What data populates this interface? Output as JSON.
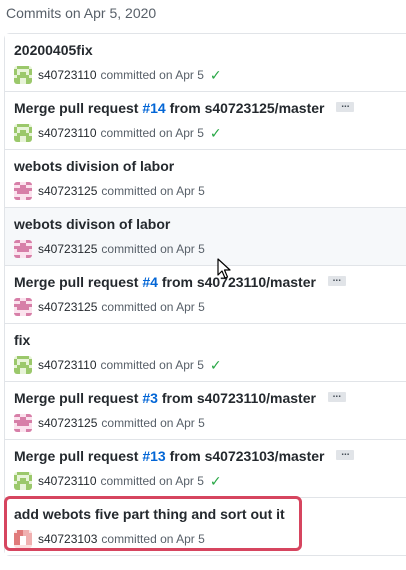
{
  "header": {
    "date_title": "Commits on Apr 5, 2020"
  },
  "commits": [
    {
      "title": "20200405fix",
      "pr": "",
      "after": "",
      "author": "s40723110",
      "date": "committed on Apr 5",
      "verified": true,
      "avatar": "green"
    },
    {
      "title": "Merge pull request ",
      "pr": "#14",
      "after": " from s40723125/master",
      "author": "s40723110",
      "date": "committed on Apr 5",
      "verified": true,
      "avatar": "green",
      "more": "..."
    },
    {
      "title": "webots division of labor",
      "pr": "",
      "after": "",
      "author": "s40723125",
      "date": "committed on Apr 5",
      "verified": false,
      "avatar": "pink"
    },
    {
      "title": "webots divison of labor",
      "pr": "",
      "after": "",
      "author": "s40723125",
      "date": "committed on Apr 5",
      "verified": false,
      "avatar": "pink"
    },
    {
      "title": "Merge pull request ",
      "pr": "#4",
      "after": " from s40723110/master",
      "author": "s40723125",
      "date": "committed on Apr 5",
      "verified": false,
      "avatar": "pink",
      "more": "..."
    },
    {
      "title": "fix",
      "pr": "",
      "after": "",
      "author": "s40723110",
      "date": "committed on Apr 5",
      "verified": true,
      "avatar": "green"
    },
    {
      "title": "Merge pull request ",
      "pr": "#3",
      "after": " from s40723110/master",
      "author": "s40723125",
      "date": "committed on Apr 5",
      "verified": false,
      "avatar": "pink",
      "more": "..."
    },
    {
      "title": "Merge pull request ",
      "pr": "#13",
      "after": " from s40723103/master",
      "author": "s40723110",
      "date": "committed on Apr 5",
      "verified": true,
      "avatar": "green",
      "more": "..."
    },
    {
      "title": "add webots five part thing and sort out it",
      "pr": "",
      "after": "",
      "author": "s40723103",
      "date": "committed on Apr 5",
      "verified": false,
      "avatar": "red"
    }
  ],
  "check_glyph": "✓",
  "colors": {
    "link": "#0366d6",
    "verified": "#28a745",
    "highlight": "#d6455f"
  }
}
